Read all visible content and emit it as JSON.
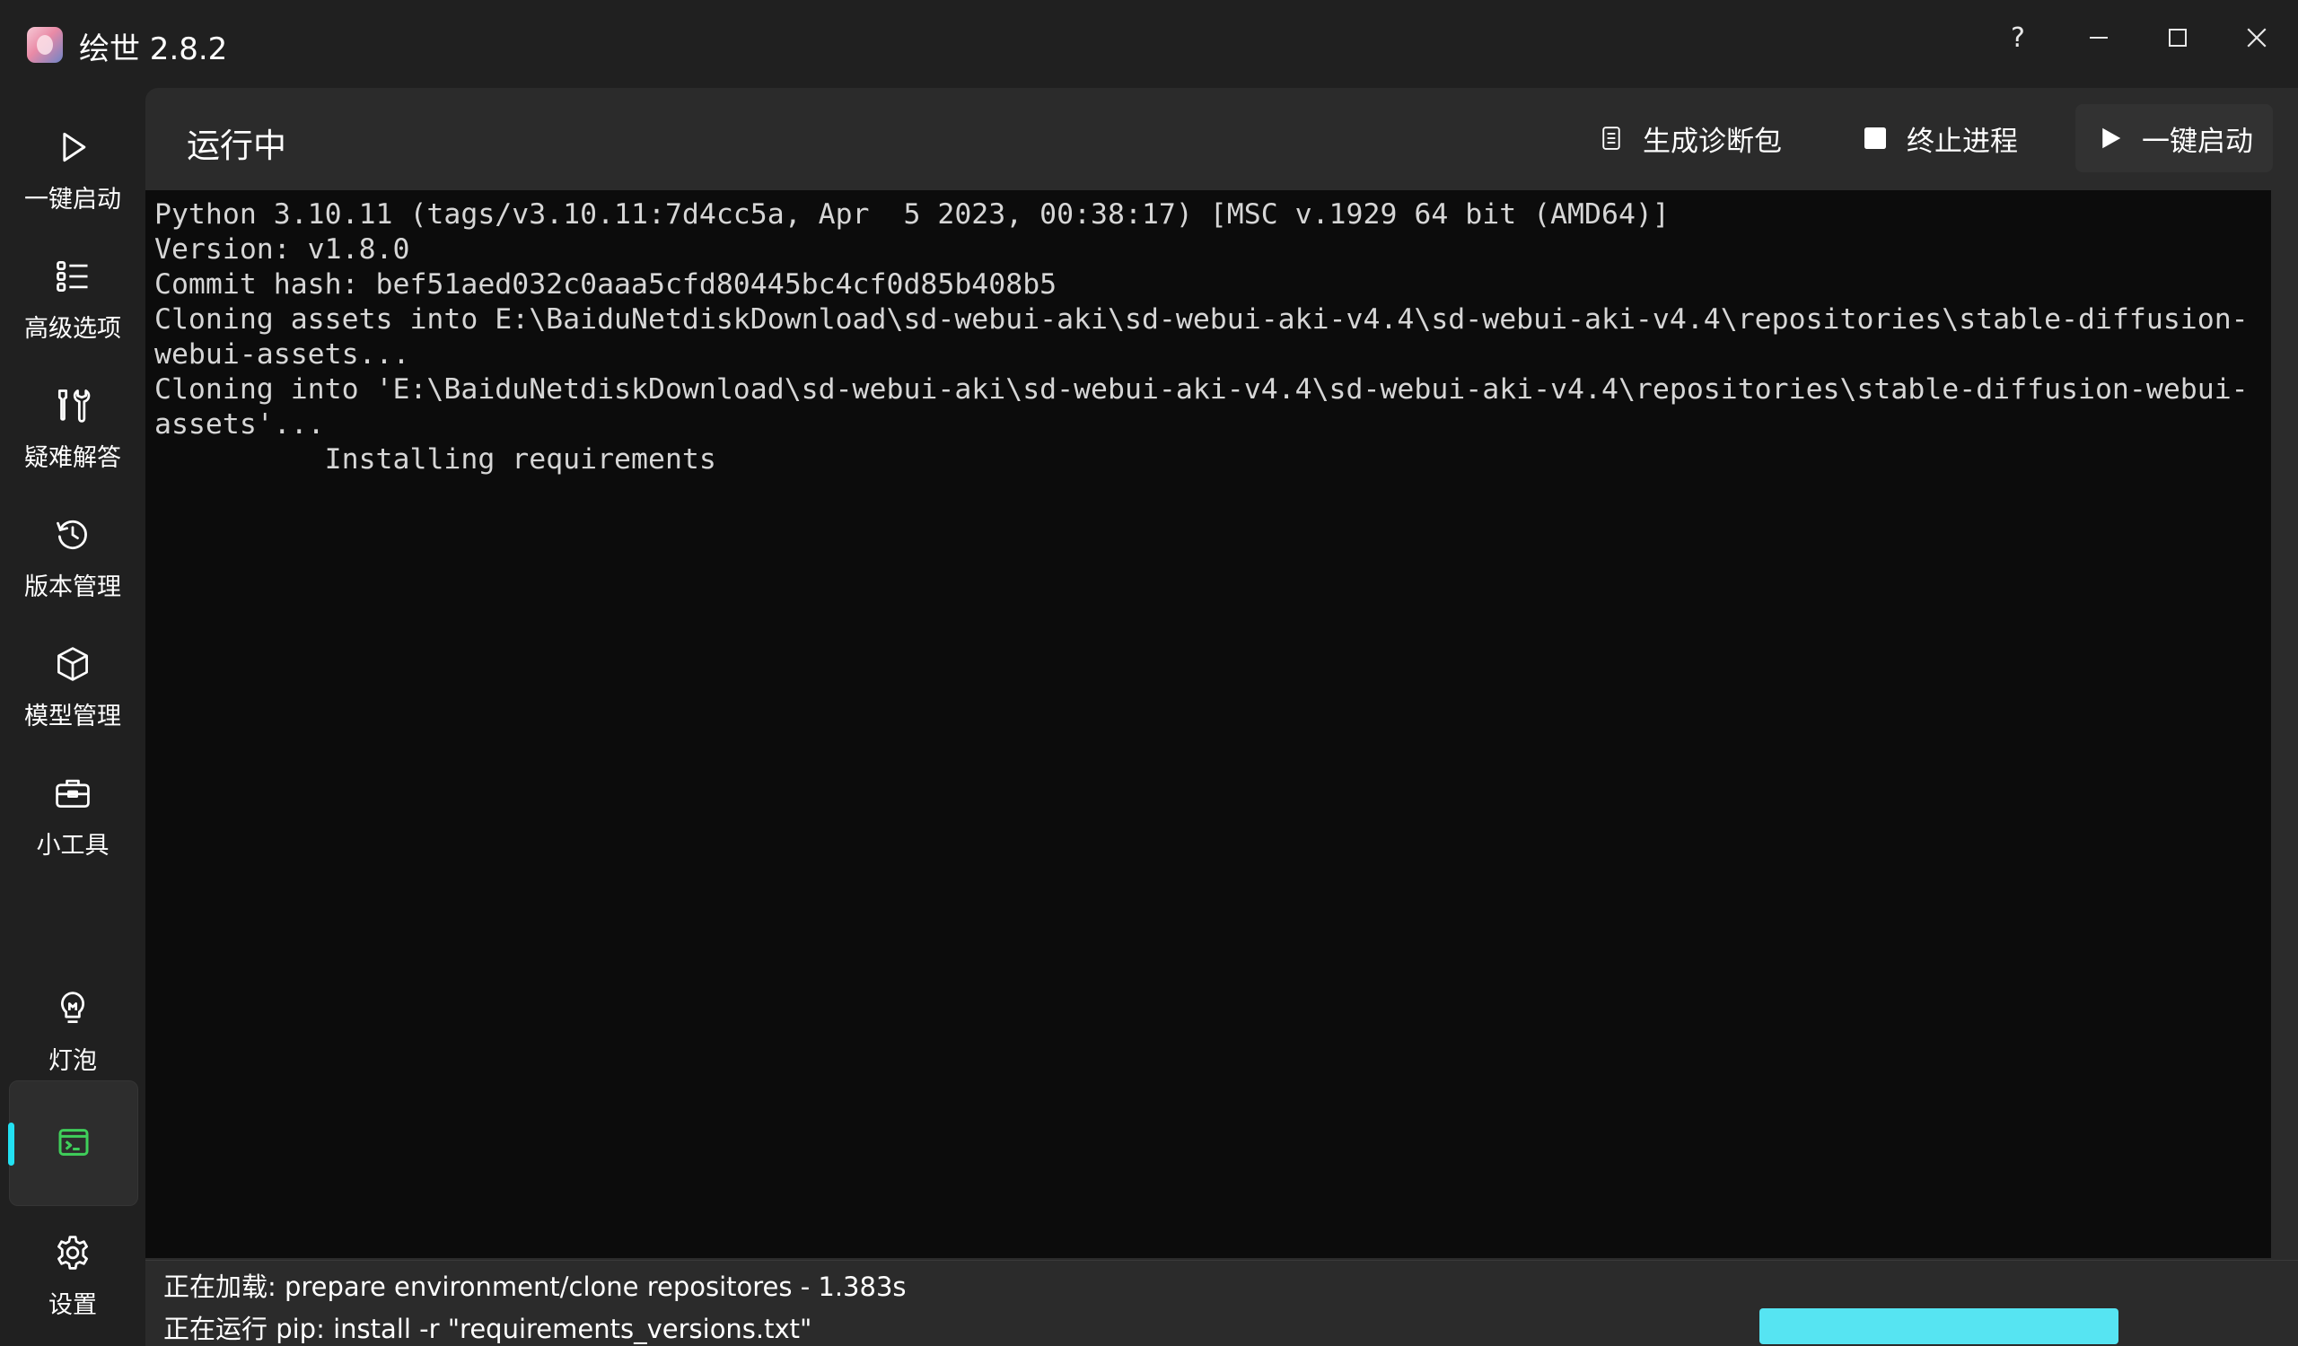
{
  "window": {
    "title": "绘世 2.8.2",
    "controls": {
      "help": "?"
    }
  },
  "sidebar": {
    "items": [
      {
        "label": "一键启动",
        "icon": "play-icon"
      },
      {
        "label": "高级选项",
        "icon": "list-icon"
      },
      {
        "label": "疑难解答",
        "icon": "tools-icon"
      },
      {
        "label": "版本管理",
        "icon": "history-icon"
      },
      {
        "label": "模型管理",
        "icon": "cube-icon"
      },
      {
        "label": "小工具",
        "icon": "toolbox-icon"
      }
    ],
    "bottom": [
      {
        "label": "灯泡",
        "icon": "lightbulb-icon"
      },
      {
        "label": "",
        "icon": "terminal-icon",
        "active": true
      },
      {
        "label": "设置",
        "icon": "gear-icon"
      }
    ]
  },
  "header": {
    "title": "运行中",
    "buttons": {
      "diagnostics": "生成诊断包",
      "stop": "终止进程",
      "launch": "一键启动"
    }
  },
  "console": {
    "lines": [
      "Python 3.10.11 (tags/v3.10.11:7d4cc5a, Apr  5 2023, 00:38:17) [MSC v.1929 64 bit (AMD64)]",
      "Version: v1.8.0",
      "Commit hash: bef51aed032c0aaa5cfd80445bc4cf0d85b408b5",
      "Cloning assets into E:\\BaiduNetdiskDownload\\sd-webui-aki\\sd-webui-aki-v4.4\\sd-webui-aki-v4.4\\repositories\\stable-diffusion-webui-assets...",
      "Cloning into 'E:\\BaiduNetdiskDownload\\sd-webui-aki\\sd-webui-aki-v4.4\\sd-webui-aki-v4.4\\repositories\\stable-diffusion-webui-assets'...",
      "          Installing requirements"
    ]
  },
  "status": {
    "loading": "正在加载: prepare environment/clone repositores - 1.383s",
    "running": "正在运行 pip: install -r \"requirements_versions.txt\"",
    "progress": 1.0
  },
  "colors": {
    "accent": "#22e1f2",
    "progress": "#56e4f2",
    "terminal_icon": "#3fcf5a"
  }
}
